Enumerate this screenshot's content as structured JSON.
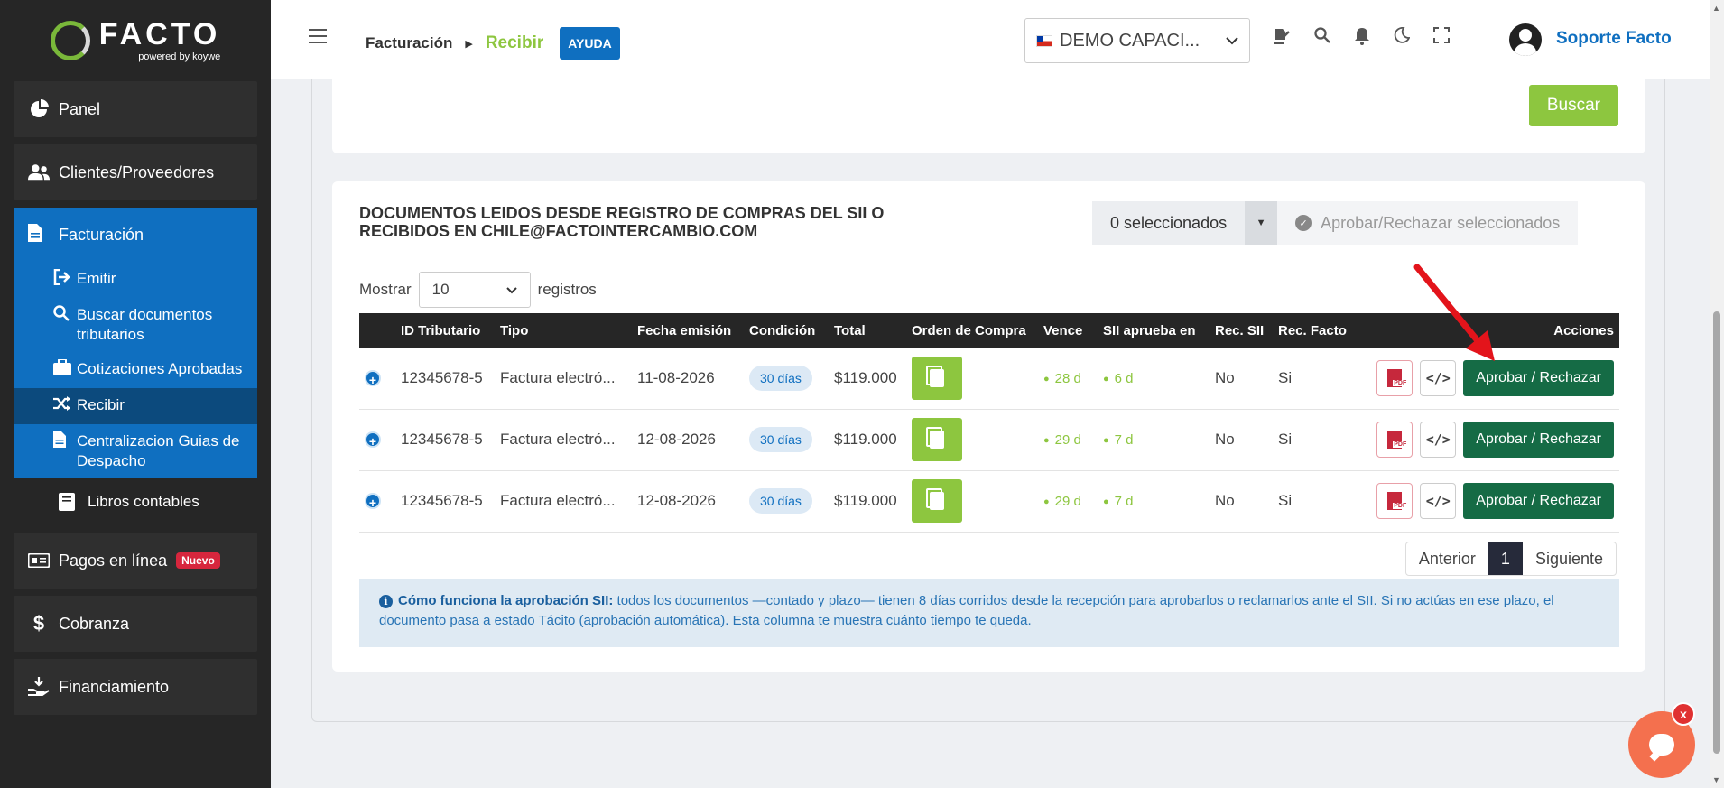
{
  "brand": {
    "name": "FACTO",
    "sub": "powered by koywe"
  },
  "sidebar": {
    "items": [
      {
        "label": "Panel",
        "icon": "pie-chart-icon"
      },
      {
        "label": "Clientes/Proveedores",
        "icon": "users-icon"
      }
    ],
    "facturacion": {
      "label": "Facturación",
      "children": [
        {
          "label": "Emitir"
        },
        {
          "label": "Buscar documentos tributarios"
        },
        {
          "label": "Cotizaciones Aprobadas"
        },
        {
          "label": "Recibir"
        },
        {
          "label": "Centralizacion Guias de Despacho"
        }
      ],
      "libros": "Libros contables"
    },
    "after": [
      {
        "label": "Pagos en línea",
        "badge": "Nuevo"
      },
      {
        "label": "Cobranza"
      },
      {
        "label": "Financiamiento"
      }
    ]
  },
  "topbar": {
    "breadcrumb_1": "Facturación",
    "breadcrumb_2": "Recibir",
    "help_label": "AYUDA",
    "company": "DEMO CAPACI...",
    "user": "Soporte Facto"
  },
  "search": {
    "button": "Buscar"
  },
  "docs": {
    "title": "DOCUMENTOS LEIDOS DESDE REGISTRO DE COMPRAS DEL SII O RECIBIDOS EN CHILE@FACTOINTERCAMBIO.COM",
    "selected": "0 seleccionados",
    "bulk_action": "Aprobar/Rechazar seleccionados",
    "show_label": "Mostrar",
    "page_len": "10",
    "records_label": "registros",
    "columns": {
      "id": "ID Tributario",
      "tipo": "Tipo",
      "fecha": "Fecha emisión",
      "cond": "Condición",
      "total": "Total",
      "oc": "Orden de Compra",
      "vence": "Vence",
      "sii": "SII aprueba en",
      "recsii": "Rec. SII",
      "recfacto": "Rec. Facto",
      "acciones": "Acciones"
    },
    "rows": [
      {
        "id": "12345678-5",
        "tipo": "Factura electró...",
        "fecha": "11-08-2026",
        "cond": "30 días",
        "total": "$119.000",
        "vence": "28 d",
        "sii": "6 d",
        "recsii": "No",
        "recfacto": "Si",
        "action": "Aprobar / Rechazar"
      },
      {
        "id": "12345678-5",
        "tipo": "Factura electró...",
        "fecha": "12-08-2026",
        "cond": "30 días",
        "total": "$119.000",
        "vence": "29 d",
        "sii": "7 d",
        "recsii": "No",
        "recfacto": "Si",
        "action": "Aprobar / Rechazar"
      },
      {
        "id": "12345678-5",
        "tipo": "Factura electró...",
        "fecha": "12-08-2026",
        "cond": "30 días",
        "total": "$119.000",
        "vence": "29 d",
        "sii": "7 d",
        "recsii": "No",
        "recfacto": "Si",
        "action": "Aprobar / Rechazar"
      }
    ],
    "pager": {
      "prev": "Anterior",
      "current": "1",
      "next": "Siguiente"
    },
    "info_title": "Cómo funciona la aprobación SII:",
    "info_text": "todos los documentos —contado y plazo— tienen 8 días corridos desde la recepción para aprobarlos o reclamarlos ante el SII. Si no actúas en ese plazo, el documento pasa a estado Tácito (aprobación automática). Esta columna te muestra cuánto tiempo te queda."
  },
  "chat": {
    "close": "x"
  },
  "colors": {
    "green": "#8dc63f",
    "blue": "#0f6fc0",
    "dark_green": "#156b45",
    "sidebar": "#262626"
  }
}
